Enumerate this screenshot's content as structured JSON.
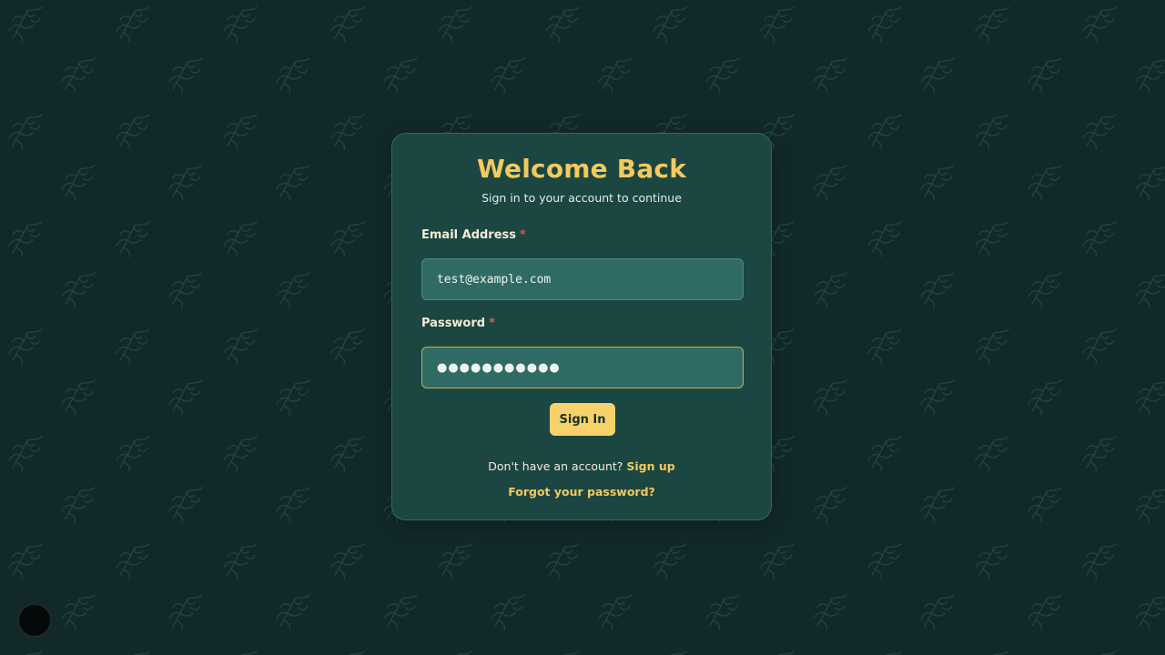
{
  "login": {
    "title": "Welcome Back",
    "subtitle": "Sign in to your account to continue",
    "email_label": "Email Address",
    "email_value": "test@example.com",
    "required_marker": "*",
    "password_label": "Password",
    "password_value": "●●●●●●●●●●●",
    "submit_label": "Sign In",
    "signup_prompt": "Don't have an account?",
    "signup_link": "Sign up",
    "forgot_link": "Forgot your password?"
  },
  "colors": {
    "background": "#12292a",
    "card": "#1b4642",
    "accent": "#f4c95d",
    "input_bg": "#2f6b64",
    "required": "#e2574c"
  },
  "icons": {
    "background_pattern": "plant-sprig-icon",
    "corner_button": "circle-button"
  }
}
